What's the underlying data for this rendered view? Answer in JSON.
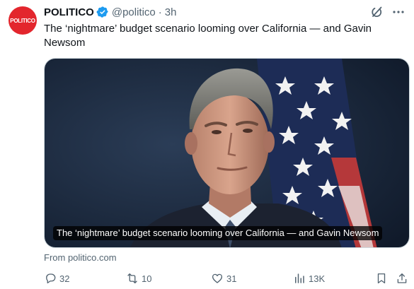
{
  "author": {
    "avatar_text": "POLITICO",
    "name": "POLITICO",
    "handle": "@politico",
    "time": "3h"
  },
  "tweet": {
    "text": "The ‘nightmare’ budget scenario looming over California — and Gavin Newsom"
  },
  "card": {
    "caption": "The ‘nightmare’ budget scenario looming over California — and Gavin Newsom",
    "source": "From politico.com"
  },
  "actions": {
    "replies": "32",
    "reposts": "10",
    "likes": "31",
    "views": "13K"
  },
  "colors": {
    "brand": "#e3262d",
    "verified": "#1d9bf0",
    "muted": "#536471"
  },
  "icons": [
    "verified-badge-icon",
    "grok-icon",
    "more-icon",
    "reply-icon",
    "repost-icon",
    "like-icon",
    "views-icon",
    "bookmark-icon",
    "share-icon"
  ]
}
